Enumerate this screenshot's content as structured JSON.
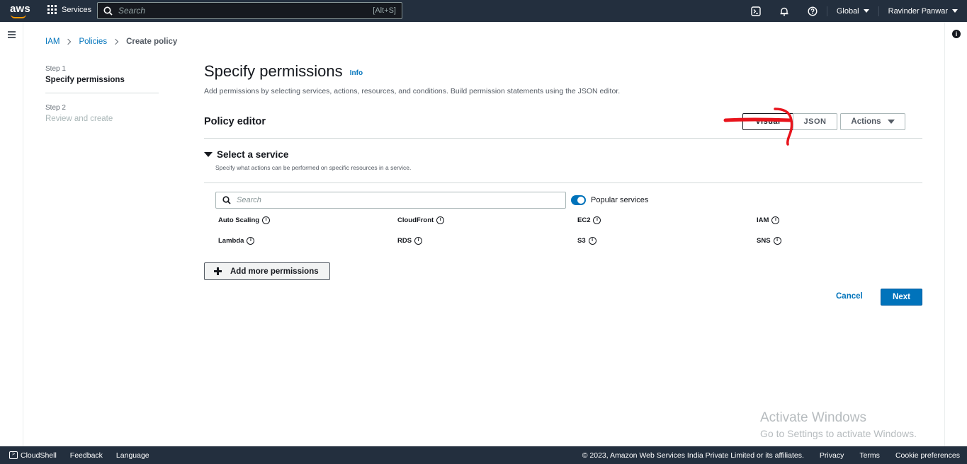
{
  "topbar": {
    "logo": "aws",
    "services_label": "Services",
    "search_placeholder": "Search",
    "search_shortcut": "[Alt+S]",
    "region": "Global",
    "user": "Ravinder Panwar"
  },
  "breadcrumb": {
    "items": [
      "IAM",
      "Policies"
    ],
    "current": "Create policy"
  },
  "steps": [
    {
      "label": "Step 1",
      "title": "Specify permissions"
    },
    {
      "label": "Step 2",
      "title": "Review and create"
    }
  ],
  "page": {
    "title": "Specify permissions",
    "info_link": "Info",
    "description": "Add permissions by selecting services, actions, resources, and conditions. Build permission statements using the JSON editor."
  },
  "policy_editor": {
    "title": "Policy editor",
    "visual_label": "Visual",
    "json_label": "JSON",
    "actions_label": "Actions"
  },
  "service_section": {
    "title": "Select a service",
    "description": "Specify what actions can be performed on specific resources in a service.",
    "search_placeholder": "Search",
    "toggle_label": "Popular services",
    "toggle_on": true,
    "services": [
      "Auto Scaling",
      "CloudFront",
      "EC2",
      "IAM",
      "Lambda",
      "RDS",
      "S3",
      "SNS"
    ]
  },
  "buttons": {
    "add_more": "Add more permissions",
    "cancel": "Cancel",
    "next": "Next"
  },
  "watermark": {
    "line1": "Activate Windows",
    "line2": "Go to Settings to activate Windows."
  },
  "footer": {
    "cloudshell": "CloudShell",
    "feedback": "Feedback",
    "language": "Language",
    "copyright": "© 2023, Amazon Web Services India Private Limited or its affiliates.",
    "privacy": "Privacy",
    "terms": "Terms",
    "cookies": "Cookie preferences"
  },
  "colors": {
    "topbar_bg": "#232f3e",
    "link": "#0073bb",
    "primary_button": "#0073bb",
    "annotation_red": "#e8141c"
  }
}
